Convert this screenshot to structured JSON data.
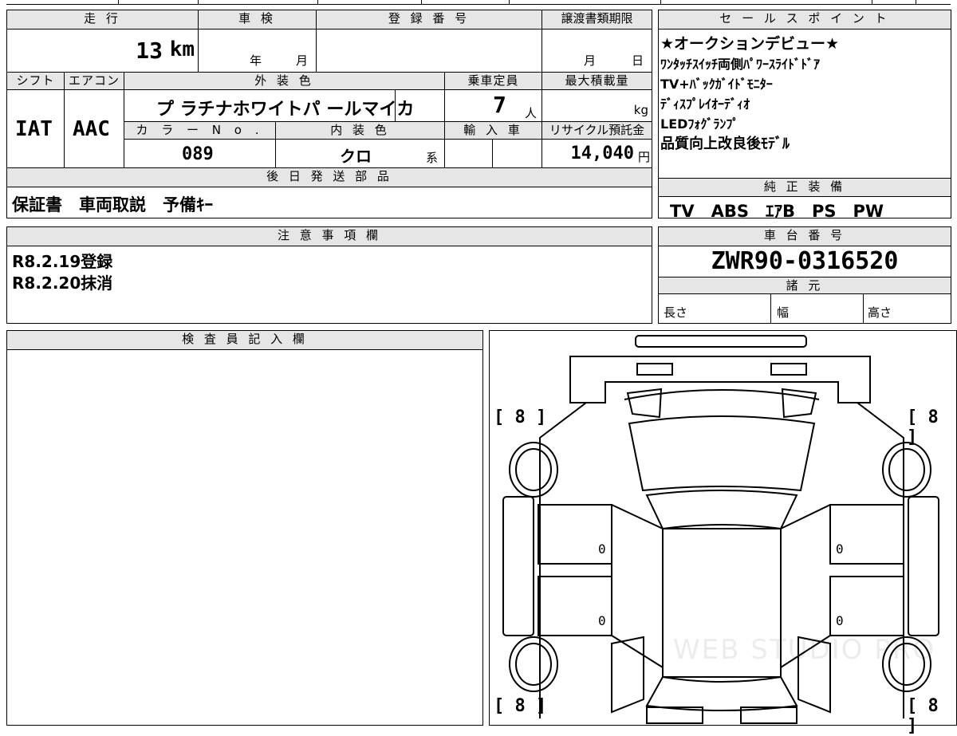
{
  "top_strip": {},
  "sheet": {
    "mileage_label": "走 行",
    "mileage_value": "13",
    "mileage_unit": "km",
    "inspection_label": "車 検",
    "inspection_year_unit": "年",
    "inspection_month_unit": "月",
    "registration_no_label": "登 録 番 号",
    "transfer_deadline_label": "譲渡書類期限",
    "transfer_month_unit": "月",
    "transfer_day_unit": "日",
    "shift_label": "シフト",
    "shift_value": "IAT",
    "ac_label": "エアコン",
    "ac_value": "AAC",
    "exterior_color_label": "外 装 色",
    "exterior_color_value": "プ ラチナホワイトパ ールマイカ",
    "capacity_label": "乗車定員",
    "capacity_value": "7",
    "capacity_unit": "人",
    "max_load_label": "最大積載量",
    "max_load_unit": "kg",
    "color_no_label": "カ ラ ー N o .",
    "color_no_value": "089",
    "interior_color_label": "内 装 色",
    "interior_color_value": "クロ",
    "interior_color_suffix": "系",
    "import_label": "輸 入 車",
    "recycle_label": "リサイクル預託金",
    "recycle_value": "14,040",
    "recycle_unit": "円",
    "later_parts_label": "後 日 発 送 部 品",
    "later_parts_value": "保証書　車両取説　予備ｷｰ"
  },
  "sales_points": {
    "label": "セ ー ル ス ポ イ ン ト",
    "lines": [
      "★オークションデビュー★",
      "ﾜﾝﾀｯﾁｽｲｯﾁ両側ﾊﾟﾜｰｽﾗｲﾄﾞﾄﾞｱ",
      "TV+ﾊﾞｯｸｶﾞｲﾄﾞﾓﾆﾀｰ",
      "ﾃﾞｨｽﾌﾟﾚｲｵｰﾃﾞｨｵ",
      "LEDﾌｫｸﾞﾗﾝﾌﾟ",
      "品質向上改良後ﾓﾃﾞﾙ"
    ]
  },
  "equipment": {
    "label": "純 正 装 備",
    "value": "TV　ABS　ｴｱB　PS　PW"
  },
  "notes": {
    "label": "注 意 事 項 欄",
    "lines": [
      "R8.2.19登録",
      "R8.2.20抹消"
    ]
  },
  "chassis": {
    "label": "車 台 番 号",
    "value": "ZWR90-0316520",
    "specs_label": "諸 元",
    "length_label": "長さ",
    "width_label": "幅",
    "height_label": "高さ"
  },
  "inspector": {
    "label": "検 査 員 記 入 欄"
  },
  "diagram": {
    "tire_fl": "[ 8 ]",
    "tire_fr": "[ 8 ]",
    "tire_rl": "[ 8 ]",
    "tire_rr": "[ 8 ]",
    "door_fl": "0",
    "door_rl": "0",
    "door_fr": "0",
    "door_rr": "0",
    "watermark": "WEB STUDIO PRO"
  }
}
